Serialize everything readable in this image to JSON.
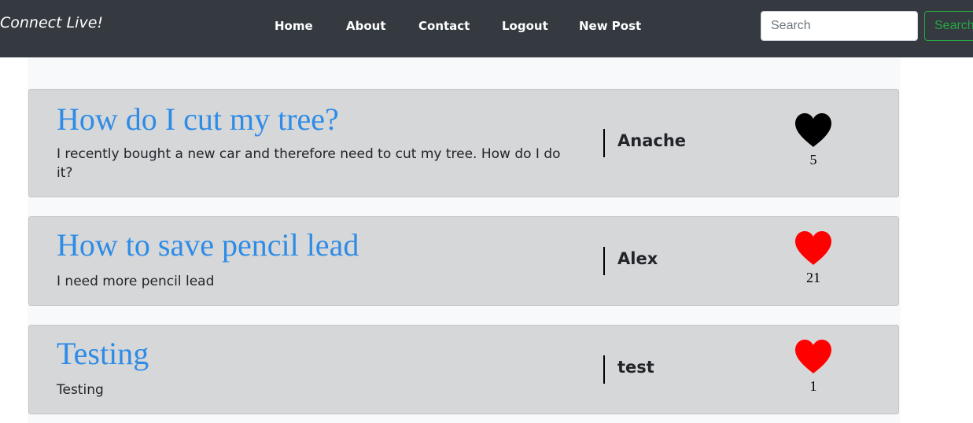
{
  "brand": "Connect Live!",
  "nav": {
    "home": "Home",
    "about": "About",
    "contact": "Contact",
    "logout": "Logout",
    "new_post": "New Post"
  },
  "search": {
    "placeholder": "Search",
    "button_label": "Search"
  },
  "posts": [
    {
      "title": "How do I cut my tree?",
      "body": "I recently bought a new car and therefore need to cut my tree. How do I do it?",
      "author": "Anache",
      "likes": "5",
      "liked": false,
      "heart_color": "#000000"
    },
    {
      "title": "How to save pencil lead",
      "body": "I need more pencil lead",
      "author": "Alex",
      "likes": "21",
      "liked": true,
      "heart_color": "#ff0000"
    },
    {
      "title": "Testing",
      "body": "Testing",
      "author": "test",
      "likes": "1",
      "liked": true,
      "heart_color": "#ff0000"
    }
  ],
  "colors": {
    "navbar": "#343a40",
    "title_link": "#2f8ce6",
    "search_button": "#28a745",
    "card_bg": "#d6d7d9"
  }
}
